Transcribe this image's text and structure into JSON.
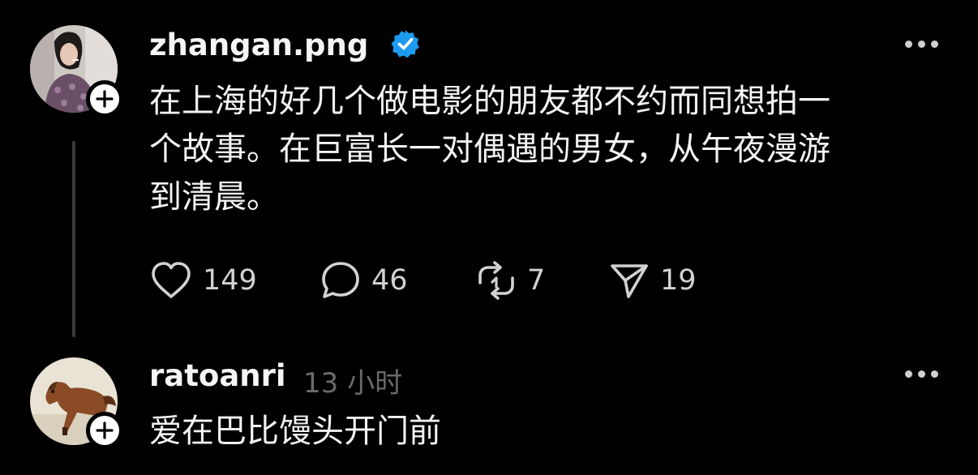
{
  "posts": [
    {
      "username": "zhangan.png",
      "verified": true,
      "avatar_icon": "avatar-photo",
      "follow_icon": "plus-icon",
      "text_lines": [
        "在上海的好几个做电影的朋友都不约而同想拍一",
        "个故事。在巨富长一对偶遇的男女，从午夜漫游",
        "到清晨。"
      ],
      "actions": {
        "likes": "149",
        "replies": "46",
        "reposts": "7",
        "shares": "19"
      }
    },
    {
      "username": "ratoanri",
      "timestamp": "13 小时",
      "avatar_icon": "horse-avatar",
      "follow_icon": "plus-icon",
      "text_lines": [
        "爱在巴比馒头开门前"
      ]
    }
  ],
  "colors": {
    "background": "#000000",
    "text": "#f3f3f3",
    "muted": "#6a6a6a",
    "verified": "#1d9bf0",
    "thread_line": "#3a3a3a"
  }
}
